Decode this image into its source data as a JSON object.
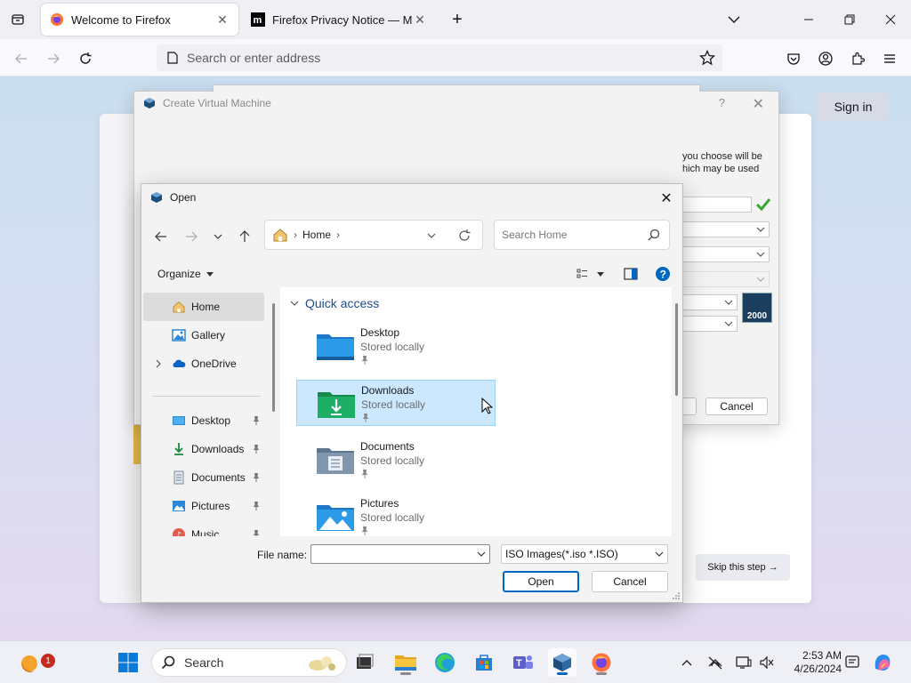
{
  "browser": {
    "tabs": [
      {
        "title": "Welcome to Firefox",
        "active": true
      },
      {
        "title": "Firefox Privacy Notice — Mozill",
        "active": false
      }
    ],
    "urlbar_placeholder": "Search or enter address",
    "accent": "#0061e0"
  },
  "page": {
    "signin_label": "Sign in",
    "skip_label": "Skip this step →"
  },
  "vbox": {
    "title": "Create Virtual Machine",
    "help": "?",
    "text": "you choose will be\nhich may be used",
    "cancel_label": "Cancel",
    "badge_label": "2000"
  },
  "open_dialog": {
    "title": "Open",
    "breadcrumb": "Home",
    "search_placeholder": "Search Home",
    "organize_label": "Organize",
    "nav_items": [
      {
        "label": "Home",
        "icon": "home-icon",
        "selected": true
      },
      {
        "label": "Gallery",
        "icon": "gallery-icon"
      },
      {
        "label": "OneDrive",
        "icon": "onedrive-icon"
      },
      {
        "label": "Desktop",
        "icon": "desktop-icon"
      },
      {
        "label": "Downloads",
        "icon": "download-icon"
      },
      {
        "label": "Documents",
        "icon": "documents-icon"
      },
      {
        "label": "Pictures",
        "icon": "pictures-icon"
      },
      {
        "label": "Music",
        "icon": "music-icon"
      }
    ],
    "quick_access_label": "Quick access",
    "folders": [
      {
        "name": "Desktop",
        "sub": "Stored locally"
      },
      {
        "name": "Downloads",
        "sub": "Stored locally",
        "selected": true
      },
      {
        "name": "Documents",
        "sub": "Stored locally"
      },
      {
        "name": "Pictures",
        "sub": "Stored locally"
      }
    ],
    "file_name_label": "File name:",
    "file_name_value": "",
    "file_type": "ISO Images(*.iso *.ISO)",
    "open_label": "Open",
    "cancel_label": "Cancel"
  },
  "taskbar": {
    "search_label": "Search",
    "time": "2:53 AM",
    "date": "4/26/2024",
    "notification_count": "1"
  }
}
